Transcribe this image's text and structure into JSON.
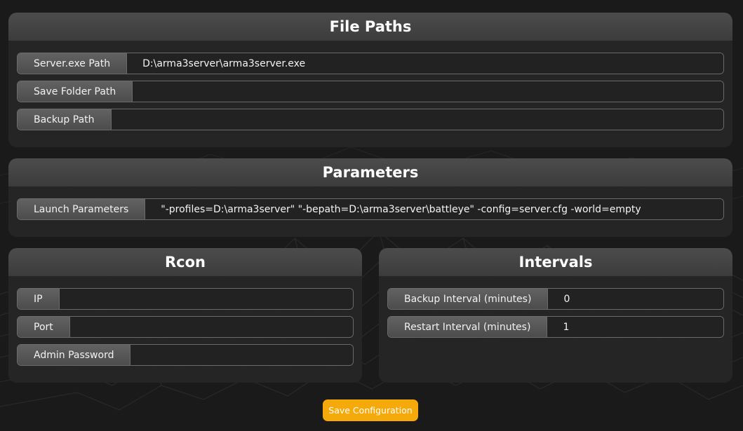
{
  "file_paths": {
    "title": "File Paths",
    "server_exe_label": "Server.exe Path",
    "server_exe_value": "D:\\arma3server\\arma3server.exe",
    "save_folder_label": "Save Folder Path",
    "save_folder_value": "",
    "backup_path_label": "Backup Path",
    "backup_path_value": ""
  },
  "parameters": {
    "title": "Parameters",
    "launch_label": "Launch Parameters",
    "launch_value": "\"-profiles=D:\\arma3server\" \"-bepath=D:\\arma3server\\battleye\" -config=server.cfg -world=empty"
  },
  "rcon": {
    "title": "Rcon",
    "ip_label": "IP",
    "ip_value": "",
    "port_label": "Port",
    "port_value": "",
    "admin_password_label": "Admin Password",
    "admin_password_value": ""
  },
  "intervals": {
    "title": "Intervals",
    "backup_interval_label": "Backup Interval (minutes)",
    "backup_interval_value": "0",
    "restart_interval_label": "Restart Interval (minutes)",
    "restart_interval_value": "1"
  },
  "save_button_label": "Save Configuration",
  "colors": {
    "background": "#1a1a1a",
    "panel": "#262626",
    "panel_header": "#444444",
    "accent": "#f5a90b"
  }
}
